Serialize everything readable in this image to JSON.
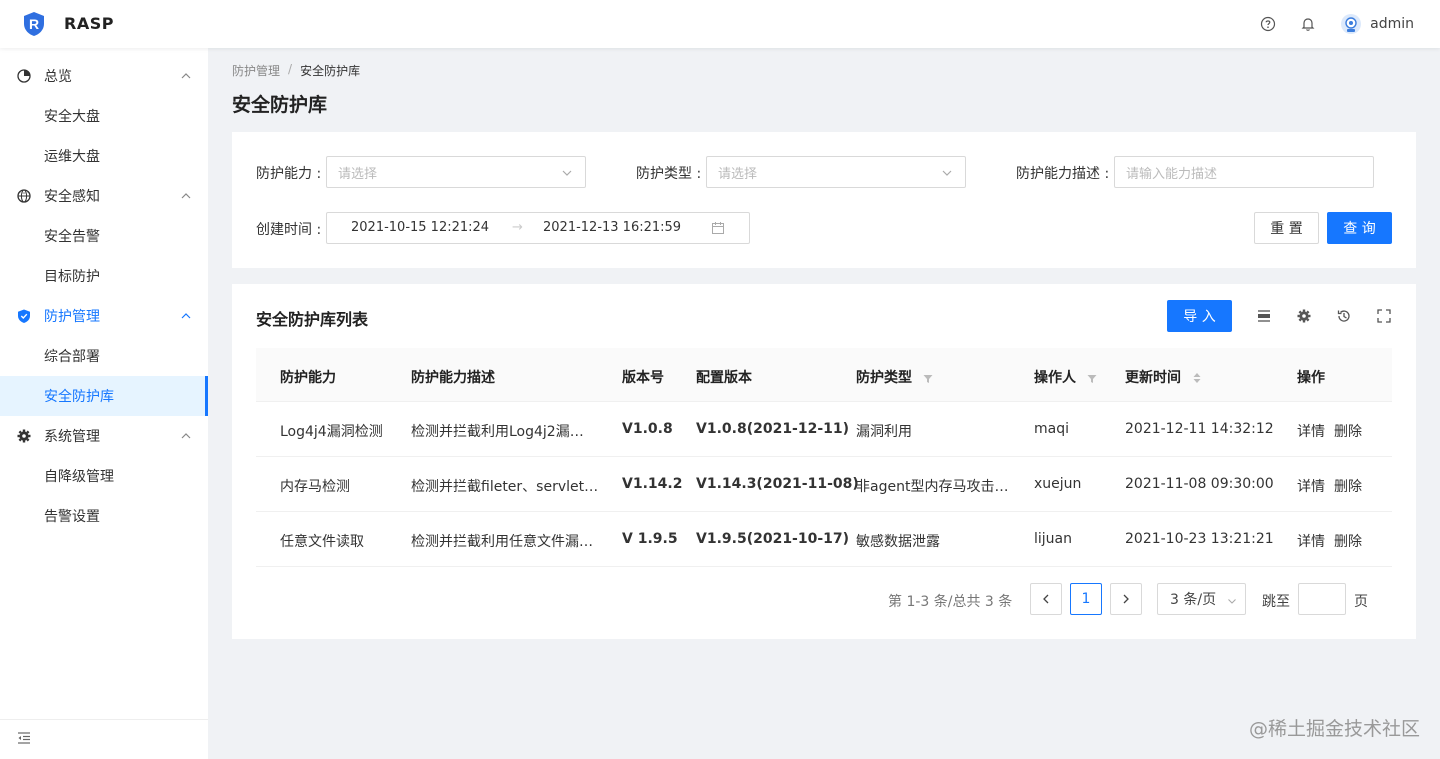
{
  "app": {
    "name": "RASP"
  },
  "header": {
    "username": "admin"
  },
  "sidebar": {
    "groups": [
      {
        "label": "总览",
        "items": [
          {
            "label": "安全大盘"
          },
          {
            "label": "运维大盘"
          }
        ]
      },
      {
        "label": "安全感知",
        "items": [
          {
            "label": "安全告警"
          },
          {
            "label": "目标防护"
          }
        ]
      },
      {
        "label": "防护管理",
        "items": [
          {
            "label": "综合部署"
          },
          {
            "label": "安全防护库"
          }
        ]
      },
      {
        "label": "系统管理",
        "items": [
          {
            "label": "自降级管理"
          },
          {
            "label": "告警设置"
          }
        ]
      }
    ]
  },
  "breadcrumb": {
    "parent": "防护管理",
    "sep": "/",
    "current": "安全防护库"
  },
  "page": {
    "title": "安全防护库"
  },
  "filters": {
    "capability_label": "防护能力 :",
    "capability_placeholder": "请选择",
    "type_label": "防护类型 :",
    "type_placeholder": "请选择",
    "desc_label": "防护能力描述 :",
    "desc_placeholder": "请输入能力描述",
    "time_label": "创建时间 :",
    "time_start": "2021-10-15   12:21:24",
    "time_arrow": "→",
    "time_end": "2021-12-13   16:21:59",
    "reset_label": "重 置",
    "query_label": "查 询"
  },
  "table": {
    "title": "安全防护库列表",
    "import_label": "导 入",
    "columns": [
      "防护能力",
      "防护能力描述",
      "版本号",
      "配置版本",
      "防护类型",
      "操作人",
      "更新时间",
      "操作"
    ],
    "rows": [
      {
        "capability": "Log4j4漏洞检测",
        "desc": "检测并拦截利用Log4j2漏…",
        "version": "V1.0.8",
        "config": "V1.0.8(2021-12-11)",
        "type": "漏洞利用",
        "operator": "maqi",
        "updated": "2021-12-11   14:32:12",
        "detail": "详情",
        "delete": "删除"
      },
      {
        "capability": "内存马检测",
        "desc": "检测并拦截fileter、servlet…",
        "version": "V1.14.2",
        "config": "V1.14.3(2021-11-08)",
        "type": "非agent型内存马攻击…",
        "operator": "xuejun",
        "updated": "2021-11-08   09:30:00",
        "detail": "详情",
        "delete": "删除"
      },
      {
        "capability": "任意文件读取",
        "desc": "检测并拦截利用任意文件漏…",
        "version": "V 1.9.5",
        "config": "V1.9.5(2021-10-17)",
        "type": "敏感数据泄露",
        "operator": " lijuan",
        "updated": "2021-10-23   13:21:21",
        "detail": "详情",
        "delete": "删除"
      }
    ]
  },
  "pagination": {
    "summary": "第 1-3 条/总共 3 条",
    "current_page": "1",
    "page_size": "3 条/页",
    "jump_label": "跳至",
    "page_suffix": "页"
  },
  "watermark": "@稀土掘金技术社区",
  "colors": {
    "primary": "#1677ff",
    "active_bg": "#e6f4ff",
    "page_bg": "#f0f2f5"
  }
}
